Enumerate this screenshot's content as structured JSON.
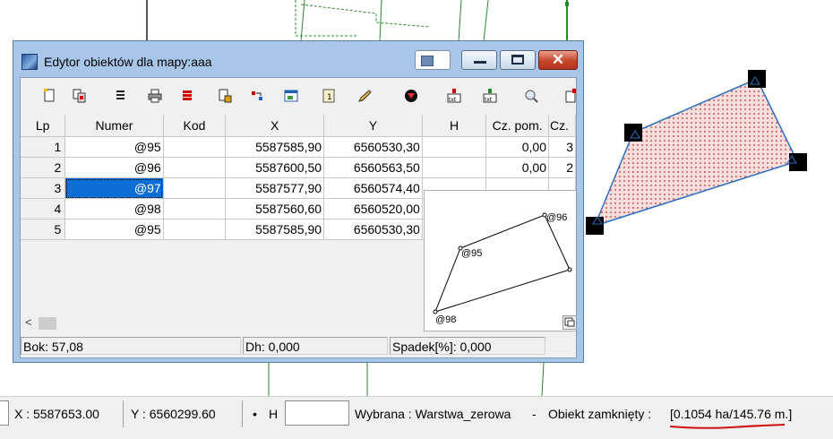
{
  "window": {
    "title": "Edytor obiektów dla mapy:aaa",
    "close_glyph": "✕"
  },
  "toolbar": {
    "icons": [
      "new-document-icon",
      "copy-icon",
      "list-icon",
      "print-icon",
      "stack-icon",
      "export-icon",
      "arrows-icon",
      "window-icon",
      "numbered-icon",
      "pencil-icon",
      "filter-icon",
      "txt-export-icon",
      "txt-import-icon",
      "zoom-icon",
      "more-icon"
    ]
  },
  "table": {
    "columns": [
      "Lp",
      "Numer",
      "Kod",
      "X",
      "Y",
      "H",
      "Cz. pom.",
      "Cz."
    ],
    "rows": [
      {
        "lp": "1",
        "numer": "@95",
        "kod": "",
        "x": "5587585,90",
        "y": "6560530,30",
        "h": "",
        "czpom": "0,00",
        "cz": "3"
      },
      {
        "lp": "2",
        "numer": "@96",
        "kod": "",
        "x": "5587600,50",
        "y": "6560563,50",
        "h": "",
        "czpom": "0,00",
        "cz": "2"
      },
      {
        "lp": "3",
        "numer": "@97",
        "kod": "",
        "x": "5587577,90",
        "y": "6560574,40",
        "h": "",
        "czpom": "",
        "cz": ""
      },
      {
        "lp": "4",
        "numer": "@98",
        "kod": "",
        "x": "5587560,60",
        "y": "6560520,00",
        "h": "",
        "czpom": "",
        "cz": ""
      },
      {
        "lp": "5",
        "numer": "@95",
        "kod": "",
        "x": "5587585,90",
        "y": "6560530,30",
        "h": "",
        "czpom": "",
        "cz": ""
      }
    ],
    "selected_row": 3
  },
  "preview": {
    "labels": [
      "@96",
      "@95",
      "@98"
    ]
  },
  "status": {
    "bok": "Bok: 57,08",
    "dh": "Dh: 0,000",
    "spadek": "Spadek[%]: 0,000"
  },
  "bottombar": {
    "x": "X : 5587653.00",
    "y": "Y : 6560299.60",
    "h_label": "H",
    "bullet": "•",
    "h_value": "",
    "wybrana": "Wybrana : Warstwa_zerowa",
    "dash": "-",
    "obiekt": "Obiekt zamknięty :",
    "area": "[0.1054 ha/145.76 m.]"
  },
  "colors": {
    "selection": "#0b6fd6",
    "polygon_line": "#2b6fbf",
    "polygon_fill": "#f7d3d3",
    "map_lines": "#1a8f1a",
    "underline": "#d01010"
  }
}
